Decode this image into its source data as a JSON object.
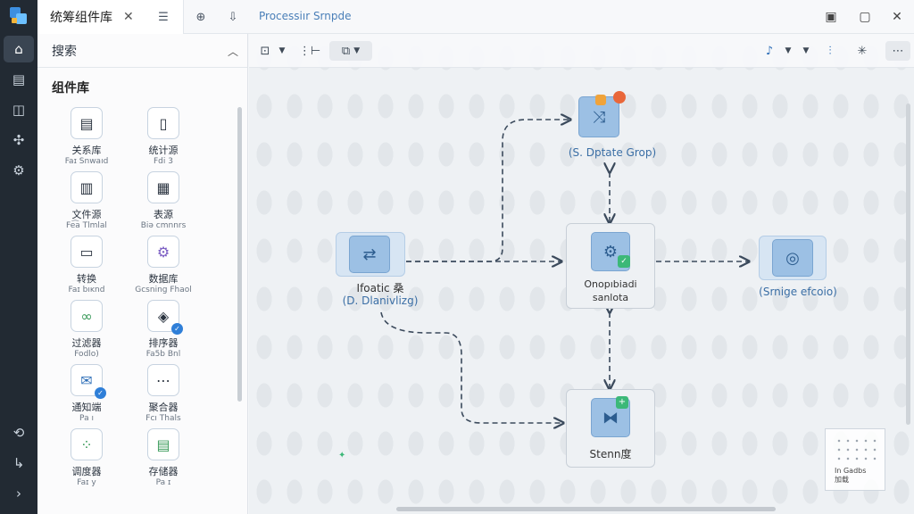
{
  "rail": {
    "icons": [
      "logo-icon",
      "home-icon",
      "flow-icon",
      "layers-icon",
      "network-icon",
      "settings-icon",
      "integration-icon",
      "export-icon",
      "expand-icon"
    ]
  },
  "topbar": {
    "lib_tab_title": "统筹组件库",
    "close_glyph": "✕",
    "canvas_tab_title": "Processiır Srnpde",
    "icons": [
      "filter-icon",
      "search-icon",
      "download-icon",
      "clipboard-icon",
      "window-icon",
      "close-icon"
    ]
  },
  "panel": {
    "search_label": "搜索",
    "library_title": "组件库",
    "components": [
      {
        "icon": "database-icon",
        "glyph": "▤",
        "label": "关系库",
        "sub": "Faɪ Snwaıd"
      },
      {
        "icon": "document-icon",
        "glyph": "▯",
        "label": "统计源",
        "sub": "F⁠di 3"
      },
      {
        "icon": "file-icon",
        "glyph": "▥",
        "label": "文件源",
        "sub": "Fe͡a Tlmlal"
      },
      {
        "icon": "table-icon",
        "glyph": "▦",
        "label": "表源",
        "sub": "Biə cmnnrs"
      },
      {
        "icon": "folder-icon",
        "glyph": "▭",
        "label": "转换",
        "sub": "Faɪ bıĸnd"
      },
      {
        "icon": "gear-icon",
        "glyph": "⚙",
        "label": "数据库",
        "sub": "Gcsning Fhaol"
      },
      {
        "icon": "link-icon",
        "glyph": "∞",
        "label": "过滤器",
        "sub": "Fodlo)"
      },
      {
        "icon": "shield-icon",
        "glyph": "◈",
        "label": "排序器",
        "sub": "Fa5b Bnl"
      },
      {
        "icon": "email-icon",
        "glyph": "✉",
        "label": "通知端",
        "sub": "Pa ı"
      },
      {
        "icon": "plugin-icon",
        "glyph": "⋯",
        "label": "聚合器",
        "sub": "Fcı Thals"
      },
      {
        "icon": "grid-icon",
        "glyph": "⁘",
        "label": "调度器",
        "sub": "Faɪ y"
      },
      {
        "icon": "cylinder-icon",
        "glyph": "▤",
        "label": "存储器",
        "sub": "Pa ɪ"
      }
    ]
  },
  "canvas": {
    "toolbar_icons": [
      "select-icon",
      "chevron-down-icon",
      "align-icon",
      "copy-icon",
      "chevron-down-icon",
      "share-icon",
      "chevron-down-icon",
      "chevron-down-icon",
      "layout-icon",
      "asterisk-icon",
      "more-icon"
    ],
    "nodes": {
      "top": {
        "label": "(S. Dptate Grop)"
      },
      "left": {
        "title": "Ifoatic 桑",
        "label": "(D. Dlanivlizg)"
      },
      "center": {
        "title": "Onopıbiadi",
        "sub": "sanlota"
      },
      "right": {
        "label": "(Srnige efcoio)"
      },
      "bottom": {
        "label": "Stenn度"
      }
    },
    "minimap_text": "In Gadbs\n加载"
  }
}
